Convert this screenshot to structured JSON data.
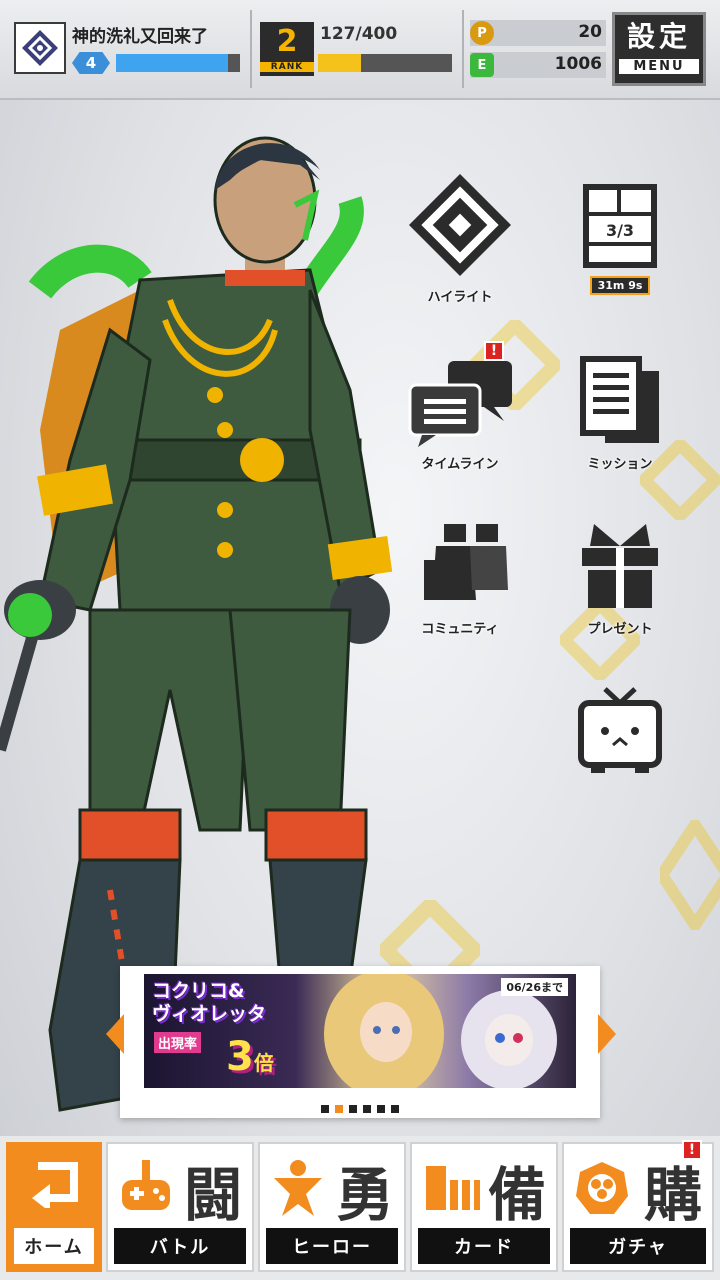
{
  "header": {
    "username": "神的洗礼又回来了",
    "level": "4",
    "level_progress": 0.9,
    "rank_number": "2",
    "rank_label": "RANK",
    "rank_exp": "127/400",
    "rank_progress": 0.32,
    "coins": "20",
    "energy": "1006",
    "coin_icon": "coin-icon",
    "energy_icon": "energy-can-icon",
    "settings_kanji": "設定",
    "menu_label": "MENU"
  },
  "side_menu": {
    "highlight": "ハイライト",
    "chapter_count": "3/3",
    "chapter_timer": "31m 9s",
    "timeline": "タイムライン",
    "mission": "ミッション",
    "community": "コミュニティ",
    "present": "プレゼント",
    "notif_mark": "!"
  },
  "banner": {
    "title_line1": "コクリコ&",
    "title_line2": "ヴィオレッタ",
    "subtitle": "出現率",
    "multiplier": "3",
    "multiplier_unit": "倍",
    "date": "06/26まで",
    "page_count": 6,
    "active_page": 1
  },
  "bottom_nav": [
    {
      "kanji": "",
      "label": "ホーム",
      "icon": "return-arrow-icon"
    },
    {
      "kanji": "闘",
      "label": "バトル",
      "icon": "gamepad-icon"
    },
    {
      "kanji": "勇",
      "label": "ヒーロー",
      "icon": "hero-icon"
    },
    {
      "kanji": "備",
      "label": "カード",
      "icon": "cards-icon"
    },
    {
      "kanji": "購",
      "label": "ガチャ",
      "icon": "gacha-icon"
    }
  ],
  "colors": {
    "accent": "#f28c1e",
    "level_bar": "#3ea4f0",
    "rank_bar": "#f4c21a",
    "notification": "#dd2222"
  }
}
